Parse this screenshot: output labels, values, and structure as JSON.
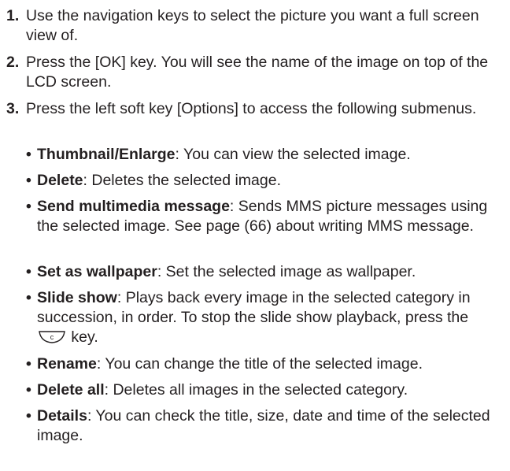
{
  "steps": [
    {
      "num": "1.",
      "text": "Use the navigation keys to select the picture you want a full screen view of."
    },
    {
      "num": "2.",
      "text": "Press the [OK] key. You will see the name of the image on top of the LCD screen."
    },
    {
      "num": "3.",
      "text": "Press the left soft key [Options] to access the following submenus."
    }
  ],
  "bullet": "•",
  "submenus": [
    {
      "term": "Thumbnail/Enlarge",
      "desc": ": You can view the selected image."
    },
    {
      "term": "Delete",
      "desc": ": Deletes the selected image."
    },
    {
      "term": "Send multimedia message",
      "desc": ": Sends MMS picture messages using the selected image. See page (66) about writing MMS message."
    },
    {
      "term": "Set as wallpaper",
      "desc": ": Set the selected image as wallpaper."
    },
    {
      "term": "Slide show",
      "desc": ": Plays back every image in the selected category in succession, in order. To stop the slide show playback, press the",
      "desc_after": " key.",
      "icon": "end-key-icon"
    },
    {
      "term": "Rename",
      "desc": ": You can change the title of the selected image."
    },
    {
      "term": "Delete all",
      "desc": ": Deletes all images in the selected category."
    },
    {
      "term": "Details",
      "desc": ": You can check the title, size, date and time of the selected image."
    }
  ]
}
